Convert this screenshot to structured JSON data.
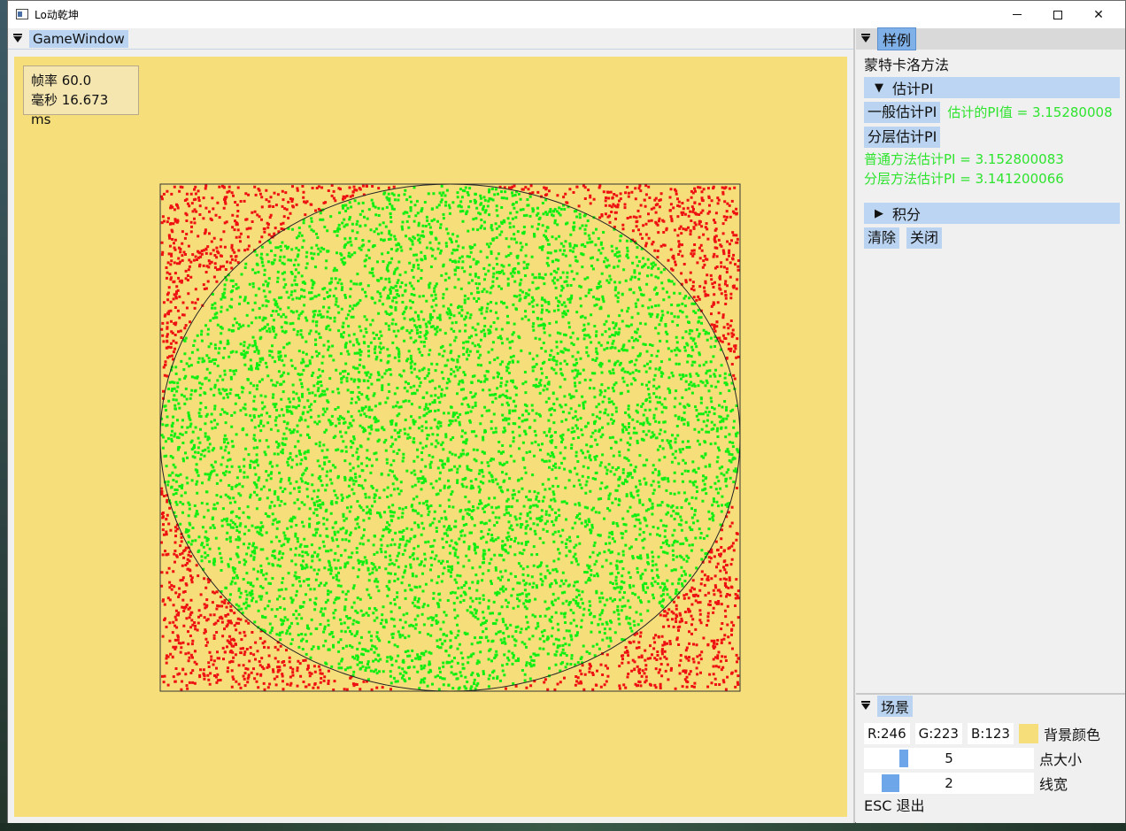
{
  "window": {
    "title": "Lo动乾坤"
  },
  "game_window": {
    "tab": "GameWindow",
    "fps_label": "帧率 60.0",
    "ms_label": "毫秒 16.673 ms",
    "background_color": "#f6df7b",
    "inside_color": "#11ee11",
    "outside_color": "#ee1111"
  },
  "sample_panel": {
    "tab": "样例",
    "method_title": "蒙特卡洛方法",
    "section_estimate": "估计PI",
    "section_estimate_arrow": "▼",
    "btn_normal": "一般估计PI",
    "estimated_value": "估计的PI值 = 3.15280008",
    "btn_stratified": "分层估计PI",
    "normal_result": "普通方法估计PI = 3.152800083",
    "stratified_result": "分层方法估计PI = 3.141200066",
    "section_integral": "积分",
    "section_integral_arrow": "▶",
    "btn_clear": "清除",
    "btn_close": "关闭"
  },
  "scene_panel": {
    "tab": "场景",
    "r": "R:246",
    "g": "G:223",
    "b": "B:123",
    "bg_color_label": "背景颜色",
    "bg_swatch": "#f6df7b",
    "point_size_value": "5",
    "point_size_label": "点大小",
    "point_size": 5,
    "line_width_value": "2",
    "line_width_label": "线宽",
    "line_width": 2,
    "esc_hint": "ESC 退出"
  }
}
